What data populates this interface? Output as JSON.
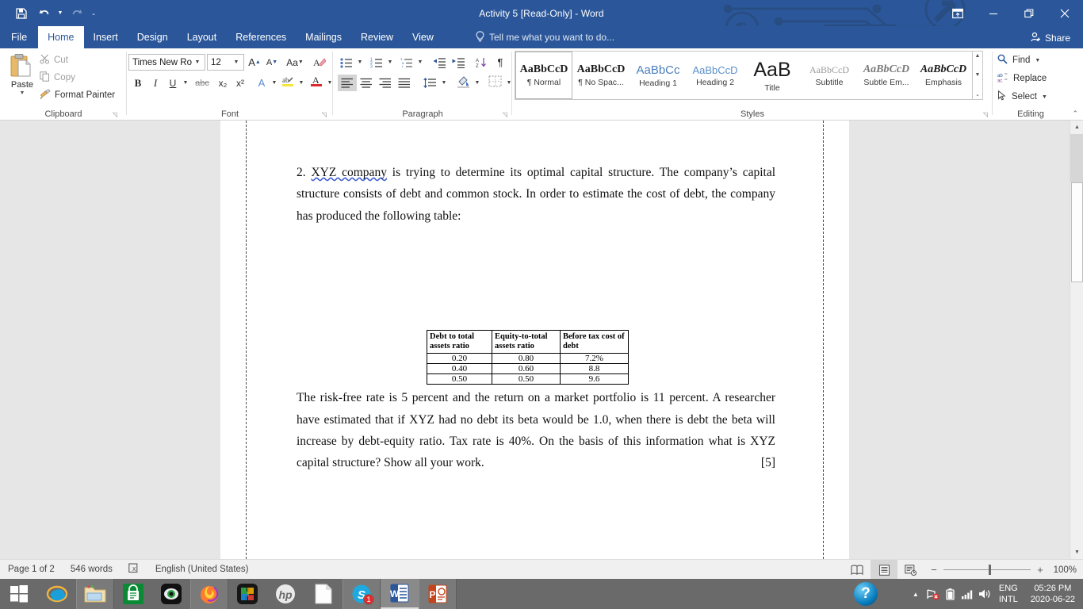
{
  "titlebar": {
    "document_title": "Activity 5 [Read-Only] - Word",
    "qat": [
      {
        "name": "save",
        "glyph": "💾"
      },
      {
        "name": "undo",
        "glyph": "↶"
      },
      {
        "name": "redo",
        "glyph": "↻"
      },
      {
        "name": "customize-quick-access-toolbar",
        "glyph": "┇"
      }
    ],
    "window_controls": [
      {
        "name": "ribbon-display-options",
        "glyph": "⬒"
      },
      {
        "name": "minimize",
        "glyph": "—"
      },
      {
        "name": "restore",
        "glyph": "❐"
      },
      {
        "name": "close",
        "glyph": "✕"
      }
    ],
    "share_label": "Share",
    "accent_color": "#2b579a"
  },
  "tabs": [
    {
      "label": "File",
      "active": false
    },
    {
      "label": "Home",
      "active": true
    },
    {
      "label": "Insert",
      "active": false
    },
    {
      "label": "Design",
      "active": false
    },
    {
      "label": "Layout",
      "active": false
    },
    {
      "label": "References",
      "active": false
    },
    {
      "label": "Mailings",
      "active": false
    },
    {
      "label": "Review",
      "active": false
    },
    {
      "label": "View",
      "active": false
    }
  ],
  "tellme": {
    "placeholder": "Tell me what you want to do..."
  },
  "ribbon": {
    "groups": [
      {
        "label": "Clipboard"
      },
      {
        "label": "Font"
      },
      {
        "label": "Paragraph"
      },
      {
        "label": "Styles"
      },
      {
        "label": "Editing"
      }
    ],
    "clipboard": {
      "paste_label": "Paste",
      "cut_label": "Cut",
      "copy_label": "Copy",
      "format_painter_label": "Format Painter"
    },
    "font": {
      "font_name": "Times New Ro",
      "font_size": "12",
      "grow_font": "A",
      "shrink_font": "A",
      "change_case": "Aa",
      "clear_formatting": "✐",
      "bold": "B",
      "italic": "I",
      "underline": "U",
      "strikethrough": "abc",
      "subscript": "x₂",
      "superscript": "x²",
      "text_effects": "A",
      "highlight": "ab",
      "font_color": "A"
    },
    "paragraph": {
      "bullets": "•≡",
      "numbering": "1≡",
      "multilevel": "≡",
      "decrease_indent": "⇤",
      "increase_indent": "⇥",
      "sort": "A↓",
      "show_marks": "¶",
      "align_left": "≡",
      "align_center": "≡",
      "align_right": "≡",
      "justify": "≡",
      "line_spacing": "↕",
      "shading": "■",
      "borders": "□"
    },
    "styles": {
      "items": [
        {
          "preview": "AaBbCcD",
          "name": "¶ Normal",
          "selected": true
        },
        {
          "preview": "AaBbCcD",
          "name": "¶ No Spac...",
          "selected": false
        },
        {
          "preview": "AaBbCс",
          "name": "Heading 1",
          "selected": false
        },
        {
          "preview": "AaBbCcD",
          "name": "Heading 2",
          "selected": false
        },
        {
          "preview": "AaB",
          "name": "Title",
          "selected": false
        },
        {
          "preview": "AaBbCcD",
          "name": "Subtitle",
          "selected": false
        },
        {
          "preview": "AaBbCcD",
          "name": "Subtle Em...",
          "selected": false
        },
        {
          "preview": "AaBbCcD",
          "name": "Emphasis",
          "selected": false
        }
      ]
    },
    "editing": {
      "find_label": "Find",
      "replace_label": "Replace",
      "select_label": "Select"
    }
  },
  "document": {
    "paragraph_1_prefix": "2. ",
    "paragraph_1_squiggle": "XYZ company",
    "paragraph_1_rest": " is trying to determine its optimal capital structure. The company’s capital structure consists of debt and common stock. In order to estimate the cost of debt, the company has produced the following table:",
    "table": {
      "headers": [
        "Debt to total assets ratio",
        "Equity-to-total assets ratio",
        "Before tax cost of debt"
      ],
      "rows": [
        [
          "0.20",
          "0.80",
          "7.2%"
        ],
        [
          "0.40",
          "0.60",
          "8.8"
        ],
        [
          "0.50",
          "0.50",
          "9.6"
        ]
      ]
    },
    "paragraph_2": "The risk-free rate is 5 percent and the return on a market portfolio is 11 percent. A researcher have estimated that if XYZ had no debt its beta would be 1.0, when there is debt the beta will increase by debt-equity ratio. Tax rate is 40%. On the basis of this information what is XYZ capital structure? Show all your work.",
    "marks": "[5]"
  },
  "statusbar": {
    "page_label": "Page 1 of 2",
    "word_count": "546 words",
    "proofing_icon": "proofing-errors-icon",
    "language": "English (United States)",
    "views": [
      {
        "name": "read-mode",
        "glyph": "📖",
        "active": false
      },
      {
        "name": "print-layout",
        "glyph": "▤",
        "active": true
      },
      {
        "name": "web-layout",
        "glyph": "▥",
        "active": false
      }
    ],
    "zoom_out": "−",
    "zoom_in": "+",
    "zoom_level": "100%"
  },
  "taskbar": {
    "items": [
      {
        "name": "start-button",
        "kind": "start"
      },
      {
        "name": "internet-explorer",
        "kind": "ie",
        "state": ""
      },
      {
        "name": "file-explorer",
        "kind": "explorer",
        "state": "open"
      },
      {
        "name": "microsoft-store",
        "kind": "store",
        "state": ""
      },
      {
        "name": "camera-app",
        "kind": "eye",
        "state": ""
      },
      {
        "name": "firefox",
        "kind": "firefox",
        "state": "open"
      },
      {
        "name": "puzzle-app",
        "kind": "puzzle",
        "state": ""
      },
      {
        "name": "hp-app",
        "kind": "hp",
        "state": ""
      },
      {
        "name": "document-app",
        "kind": "doc",
        "state": ""
      },
      {
        "name": "skype",
        "kind": "skype",
        "state": "open",
        "badge": "1"
      },
      {
        "name": "word",
        "kind": "word",
        "state": "active"
      },
      {
        "name": "powerpoint",
        "kind": "powerpoint",
        "state": "open"
      }
    ],
    "tray": {
      "show_hidden": "▲",
      "network_icon": "network-disconnected-icon",
      "battery_icon": "battery-icon",
      "signal_icon": "signal-icon",
      "volume_icon": "volume-icon",
      "language_line1": "ENG",
      "language_line2": "INTL",
      "time": "05:26 PM",
      "date": "2020-06-22"
    },
    "help_glyph": "?"
  }
}
